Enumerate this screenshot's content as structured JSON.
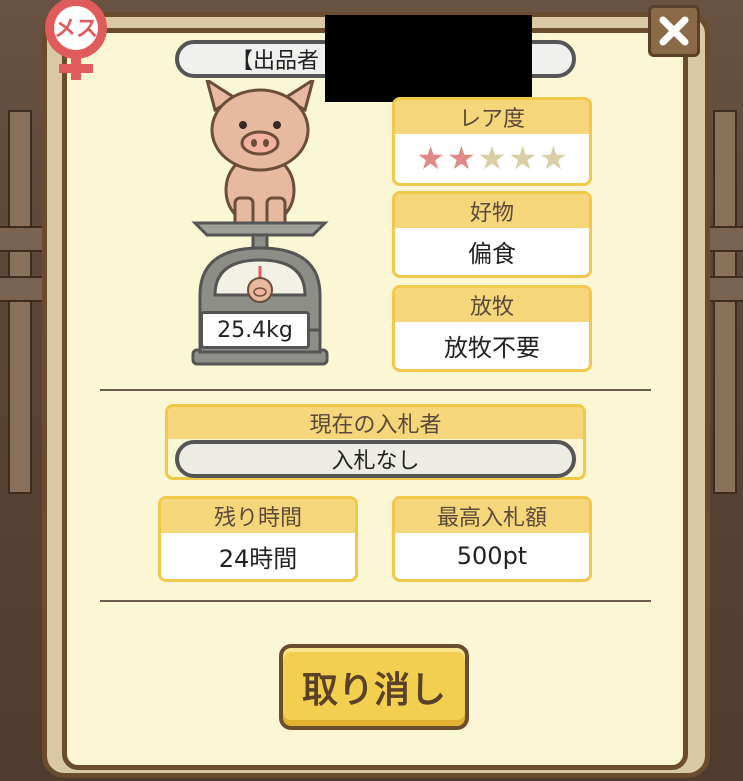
{
  "gender": {
    "label": "メス",
    "color": "#e05b5b"
  },
  "close": {
    "label": "✕",
    "icon": "close-icon"
  },
  "exhibitor": {
    "label": "【出品者"
  },
  "pig": {
    "weight": "25.4kg",
    "icon": "pig-icon"
  },
  "rarity": {
    "header": "レア度",
    "stars_filled": 2,
    "stars_total": 5,
    "filled_color": "#e08a86",
    "empty_color": "#d8cfa6"
  },
  "favorite": {
    "header": "好物",
    "value": "偏食"
  },
  "pasture": {
    "header": "放牧",
    "value": "放牧不要"
  },
  "bidder": {
    "header": "現在の入札者",
    "value": "入札なし"
  },
  "remaining": {
    "header": "残り時間",
    "value": "24時間"
  },
  "max_bid": {
    "header": "最高入札額",
    "value": "500pt"
  },
  "cancel": {
    "label": "取り消し"
  }
}
